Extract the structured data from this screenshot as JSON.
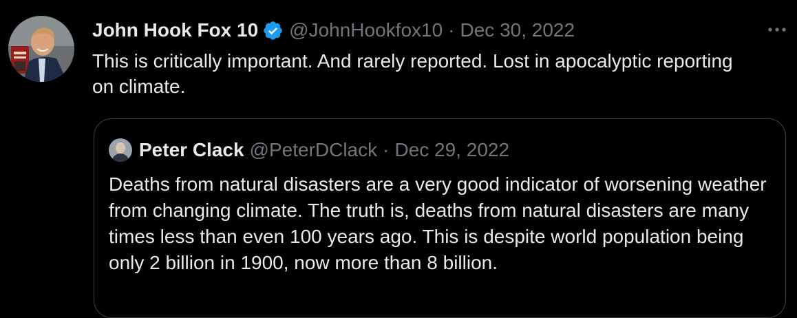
{
  "tweet": {
    "author": {
      "name": "John Hook Fox 10",
      "handle": "@JohnHookfox10",
      "verified": true,
      "avatar_icon": "profile-photo"
    },
    "separator": "·",
    "date": "Dec 30, 2022",
    "text": "This is critically important. And rarely reported. Lost in apocalyptic reporting on climate.",
    "more_icon": "more-horizontal-icon"
  },
  "quoted_tweet": {
    "author": {
      "name": "Peter Clack",
      "handle": "@PeterDClack",
      "avatar_icon": "profile-photo"
    },
    "separator": "·",
    "date": "Dec 29, 2022",
    "text": "Deaths from natural disasters are a very good indicator of worsening weather from changing climate. The truth is, deaths from natural disasters are many times less than even 100 years ago. This is despite world population being only 2 billion in 1900, now more than 8 billion."
  },
  "colors": {
    "background": "#000000",
    "text_primary": "#e7e9ea",
    "text_muted": "#71767b",
    "verified_blue": "#1d9bf0",
    "quote_border": "#3e4144"
  }
}
